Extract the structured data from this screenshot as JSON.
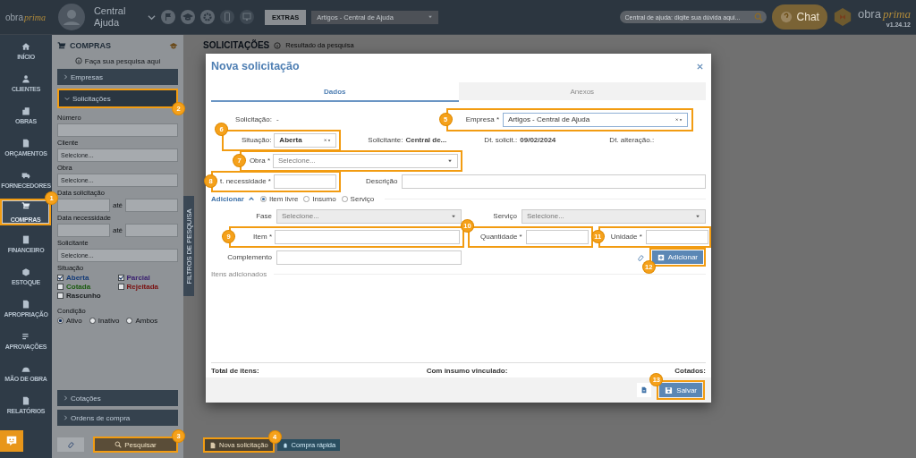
{
  "topbar": {
    "logo_word": "obra",
    "logo_script": "prima",
    "user_name": "Central Ajuda",
    "extras": "EXTRAS",
    "company": "Artigos - Central de Ajuda",
    "help_search": {
      "placeholder": "Central de ajuda: digite sua dúvida aqui..."
    },
    "chat": "Chat",
    "brand_word": "obra",
    "brand_script": "prima",
    "version": "v1.24.12"
  },
  "nav": [
    {
      "label": "INÍCIO",
      "selected": false
    },
    {
      "label": "CLIENTES",
      "selected": false
    },
    {
      "label": "OBRAS",
      "selected": false
    },
    {
      "label": "ORÇAMENTOS",
      "selected": false
    },
    {
      "label": "FORNECEDORES",
      "selected": false
    },
    {
      "label": "COMPRAS",
      "selected": true,
      "step": "1"
    },
    {
      "label": "FINANCEIRO",
      "selected": false
    },
    {
      "label": "ESTOQUE",
      "selected": false
    },
    {
      "label": "APROPRIAÇÃO",
      "selected": false
    },
    {
      "label": "APROVAÇÕES",
      "selected": false
    },
    {
      "label": "MÃO DE OBRA",
      "selected": false
    },
    {
      "label": "RELATÓRIOS",
      "selected": false
    }
  ],
  "filter_panel": {
    "title": "COMPRAS",
    "hint": "Faça sua pesquisa aqui",
    "sections_top": [
      {
        "label": "Empresas",
        "expanded": false
      },
      {
        "label": "Solicitações",
        "expanded": true,
        "step": "2"
      }
    ],
    "fields": [
      {
        "kind": "text",
        "label": "Número"
      },
      {
        "kind": "select",
        "label": "Cliente",
        "placeholder": "Selecione..."
      },
      {
        "kind": "select",
        "label": "Obra",
        "placeholder": "Selecione..."
      },
      {
        "kind": "range",
        "label": "Data solicitação",
        "separator": "até"
      },
      {
        "kind": "range",
        "label": "Data necessidade",
        "separator": "até"
      },
      {
        "kind": "select",
        "label": "Solicitante",
        "placeholder": "Selecione..."
      }
    ],
    "situacao": {
      "label": "Situação",
      "options": [
        {
          "label": "Aberta",
          "checked": true,
          "color": "#123a78"
        },
        {
          "label": "Parcial",
          "checked": true,
          "color": "#3a2070"
        },
        {
          "label": "Cotada",
          "checked": false,
          "color": "#1c5c10"
        },
        {
          "label": "Rejeitada",
          "checked": false,
          "color": "#7a1010"
        },
        {
          "label": "Rascunho",
          "checked": false,
          "color": "#1a1d20"
        }
      ]
    },
    "condicao": {
      "label": "Condição",
      "options": [
        {
          "label": "Ativo",
          "selected": true
        },
        {
          "label": "Inativo",
          "selected": false
        },
        {
          "label": "Ambos",
          "selected": false
        }
      ]
    },
    "sections_bottom": [
      {
        "label": "Cotações",
        "expanded": false
      },
      {
        "label": "Ordens de compra",
        "expanded": false
      }
    ],
    "search_button": {
      "label": "Pesquisar",
      "step": "3"
    }
  },
  "side_tab": "FILTROS DE PESQUISA",
  "main": {
    "title": "SOLICITAÇÕES",
    "subtitle": "Resultado da pesquisa",
    "actions": [
      {
        "label": "Nova solicitação",
        "kind": "new",
        "step": "4"
      },
      {
        "label": "Compra rápida",
        "kind": "quick"
      }
    ]
  },
  "modal": {
    "title": "Nova solicitação",
    "tabs": [
      {
        "label": "Dados",
        "selected": true
      },
      {
        "label": "Anexos",
        "selected": false
      }
    ],
    "solicitacao": {
      "label": "Solicitação:",
      "value": "-"
    },
    "empresa": {
      "label": "Empresa *",
      "value": "Artigos - Central de Ajuda",
      "step": "5"
    },
    "situacao": {
      "label": "Situação:",
      "value": "Aberta",
      "step": "6"
    },
    "info": [
      {
        "label": "Solicitante:",
        "value": "Central de..."
      },
      {
        "label": "Dt. solicit.:",
        "value": "09/02/2024"
      },
      {
        "label": "Dt. alteração.:"
      }
    ],
    "obra": {
      "label": "Obra *",
      "placeholder": "Selecione...",
      "step": "7"
    },
    "dt_necessidade": {
      "label": "t. necessidade *",
      "step": "8"
    },
    "descricao": {
      "label": "Descrição"
    },
    "adicionar": {
      "label": "Adicionar",
      "expanded": true,
      "types": [
        {
          "label": "Item livre",
          "selected": true
        },
        {
          "label": "Insumo",
          "selected": false
        },
        {
          "label": "Serviço",
          "selected": false
        }
      ]
    },
    "fase": {
      "label": "Fase",
      "placeholder": "Selecione...",
      "disabled": true
    },
    "servico": {
      "label": "Serviço",
      "placeholder": "Selecione...",
      "disabled": true
    },
    "item": {
      "label": "Item *",
      "step": "9"
    },
    "quantidade": {
      "label": "Quantidade *",
      "step": "10"
    },
    "unidade": {
      "label": "Unidade *",
      "step": "11"
    },
    "complemento": {
      "label": "Complemento"
    },
    "add_button": {
      "label": "Adicionar",
      "step": "12"
    },
    "items_heading": "Itens adicionados",
    "totals": [
      "Total de itens:",
      "Com insumo vinculado:",
      "Cotados:"
    ],
    "save_button": {
      "label": "Salvar",
      "step": "13"
    }
  }
}
